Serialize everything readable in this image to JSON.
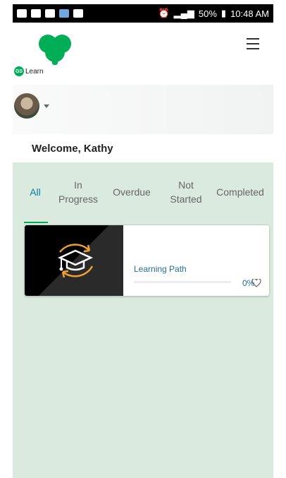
{
  "status_bar": {
    "battery": "50%",
    "time": "10:48 AM"
  },
  "header": {
    "app_label": "Learn",
    "gs_badge": "GS"
  },
  "welcome": "Welcome, Kathy",
  "tabs": [
    {
      "label": "All",
      "active": true
    },
    {
      "label": "In\nProgress",
      "active": false
    },
    {
      "label": "Overdue",
      "active": false
    },
    {
      "label": "Not\nStarted",
      "active": false
    },
    {
      "label": "Completed",
      "active": false
    }
  ],
  "card": {
    "title": "Learning Path",
    "progress_percent": "0%",
    "progress_value": 0
  },
  "colors": {
    "brand_green": "#00ae58",
    "link_blue": "#1f6fa0",
    "content_bg": "#daeadf",
    "icon_orange": "#f0a030"
  }
}
